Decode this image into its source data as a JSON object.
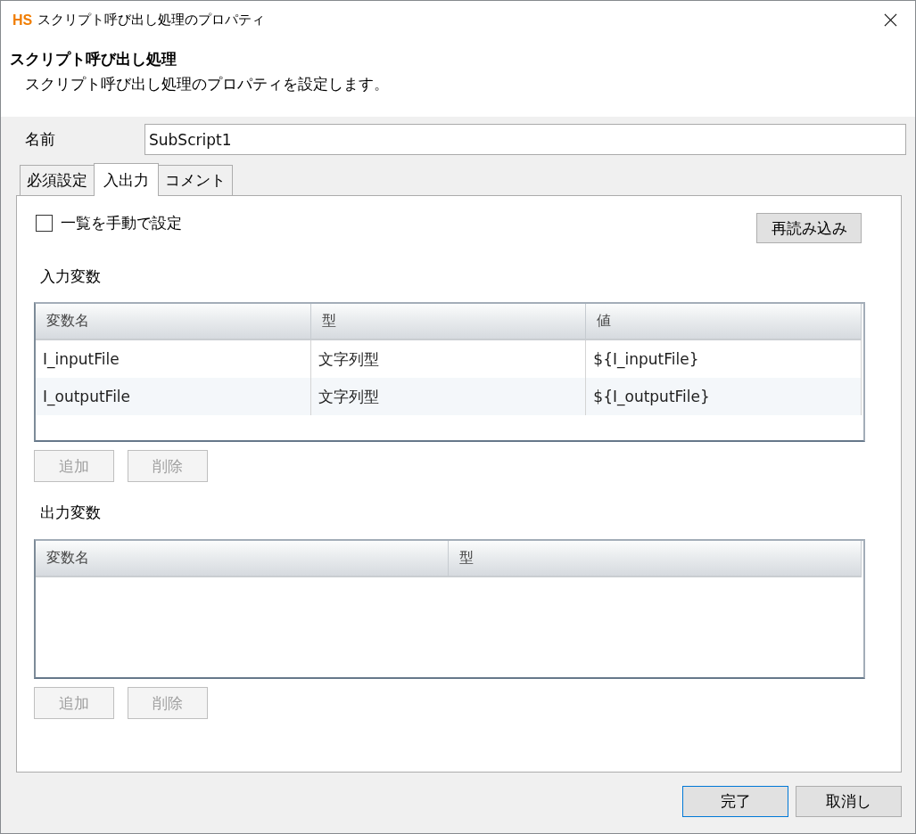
{
  "window": {
    "logo": "HS",
    "title": "スクリプト呼び出し処理のプロパティ"
  },
  "header": {
    "title": "スクリプト呼び出し処理",
    "description": "スクリプト呼び出し処理のプロパティを設定します。"
  },
  "name_field": {
    "label": "名前",
    "value": "SubScript1"
  },
  "tabs": [
    {
      "label": "必須設定",
      "selected": false
    },
    {
      "label": "入出力",
      "selected": true
    },
    {
      "label": "コメント",
      "selected": false
    }
  ],
  "manual_list_checkbox": {
    "label": "一覧を手動で設定",
    "checked": false
  },
  "reload_button": {
    "label": "再読み込み"
  },
  "input_variables": {
    "title": "入力変数",
    "columns": [
      "変数名",
      "型",
      "値"
    ],
    "rows": [
      [
        "I_inputFile",
        "文字列型",
        "${I_inputFile}"
      ],
      [
        "I_outputFile",
        "文字列型",
        "${I_outputFile}"
      ]
    ],
    "buttons": [
      {
        "label": "追加",
        "disabled": true
      },
      {
        "label": "削除",
        "disabled": true
      }
    ]
  },
  "output_variables": {
    "title": "出力変数",
    "columns": [
      "変数名",
      "型"
    ],
    "buttons": [
      {
        "label": "追加",
        "disabled": true
      },
      {
        "label": "削除",
        "disabled": true
      }
    ]
  },
  "footer_buttons": [
    {
      "label": "完了",
      "default": true
    },
    {
      "label": "取消し",
      "default": false
    }
  ]
}
